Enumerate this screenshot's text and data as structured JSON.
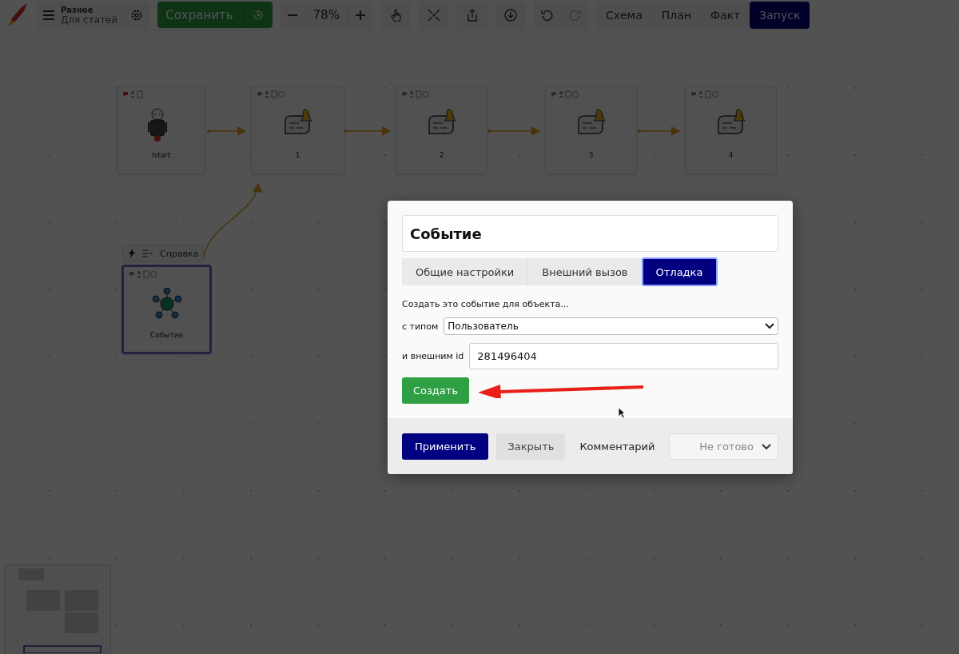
{
  "toolbar": {
    "project": {
      "title": "Разное",
      "subtitle": "Для статей"
    },
    "save_label": "Сохранить",
    "zoom": "78%",
    "views": [
      {
        "label": "Схема",
        "selected": false
      },
      {
        "label": "План",
        "selected": false
      },
      {
        "label": "Факт",
        "selected": false
      },
      {
        "label": "Запуск",
        "selected": true
      }
    ]
  },
  "canvas": {
    "nodes": [
      {
        "kind": "bot",
        "label": "/start",
        "selected": false
      },
      {
        "kind": "message",
        "label": "1",
        "selected": false
      },
      {
        "kind": "message",
        "label": "2",
        "selected": false
      },
      {
        "kind": "message",
        "label": "3",
        "selected": false
      },
      {
        "kind": "message",
        "label": "4",
        "selected": false
      },
      {
        "kind": "event",
        "label": "Событие",
        "selected": true
      }
    ],
    "node_toolbar": {
      "label": "Справка"
    }
  },
  "dialog": {
    "title": "Событие",
    "tabs": [
      {
        "label": "Общие настройки",
        "selected": false
      },
      {
        "label": "Внешний вызов",
        "selected": false
      },
      {
        "label": "Отладка",
        "selected": true
      }
    ],
    "intro": "Создать это событие для объекта...",
    "type_label": "с типом",
    "type_value": "Пользователь",
    "id_label": "и внешним id",
    "id_value": "281496404",
    "create_label": "Создать",
    "apply_label": "Применить",
    "close_label": "Закрыть",
    "comment_label": "Комментарий",
    "status_value": "Не готово"
  }
}
